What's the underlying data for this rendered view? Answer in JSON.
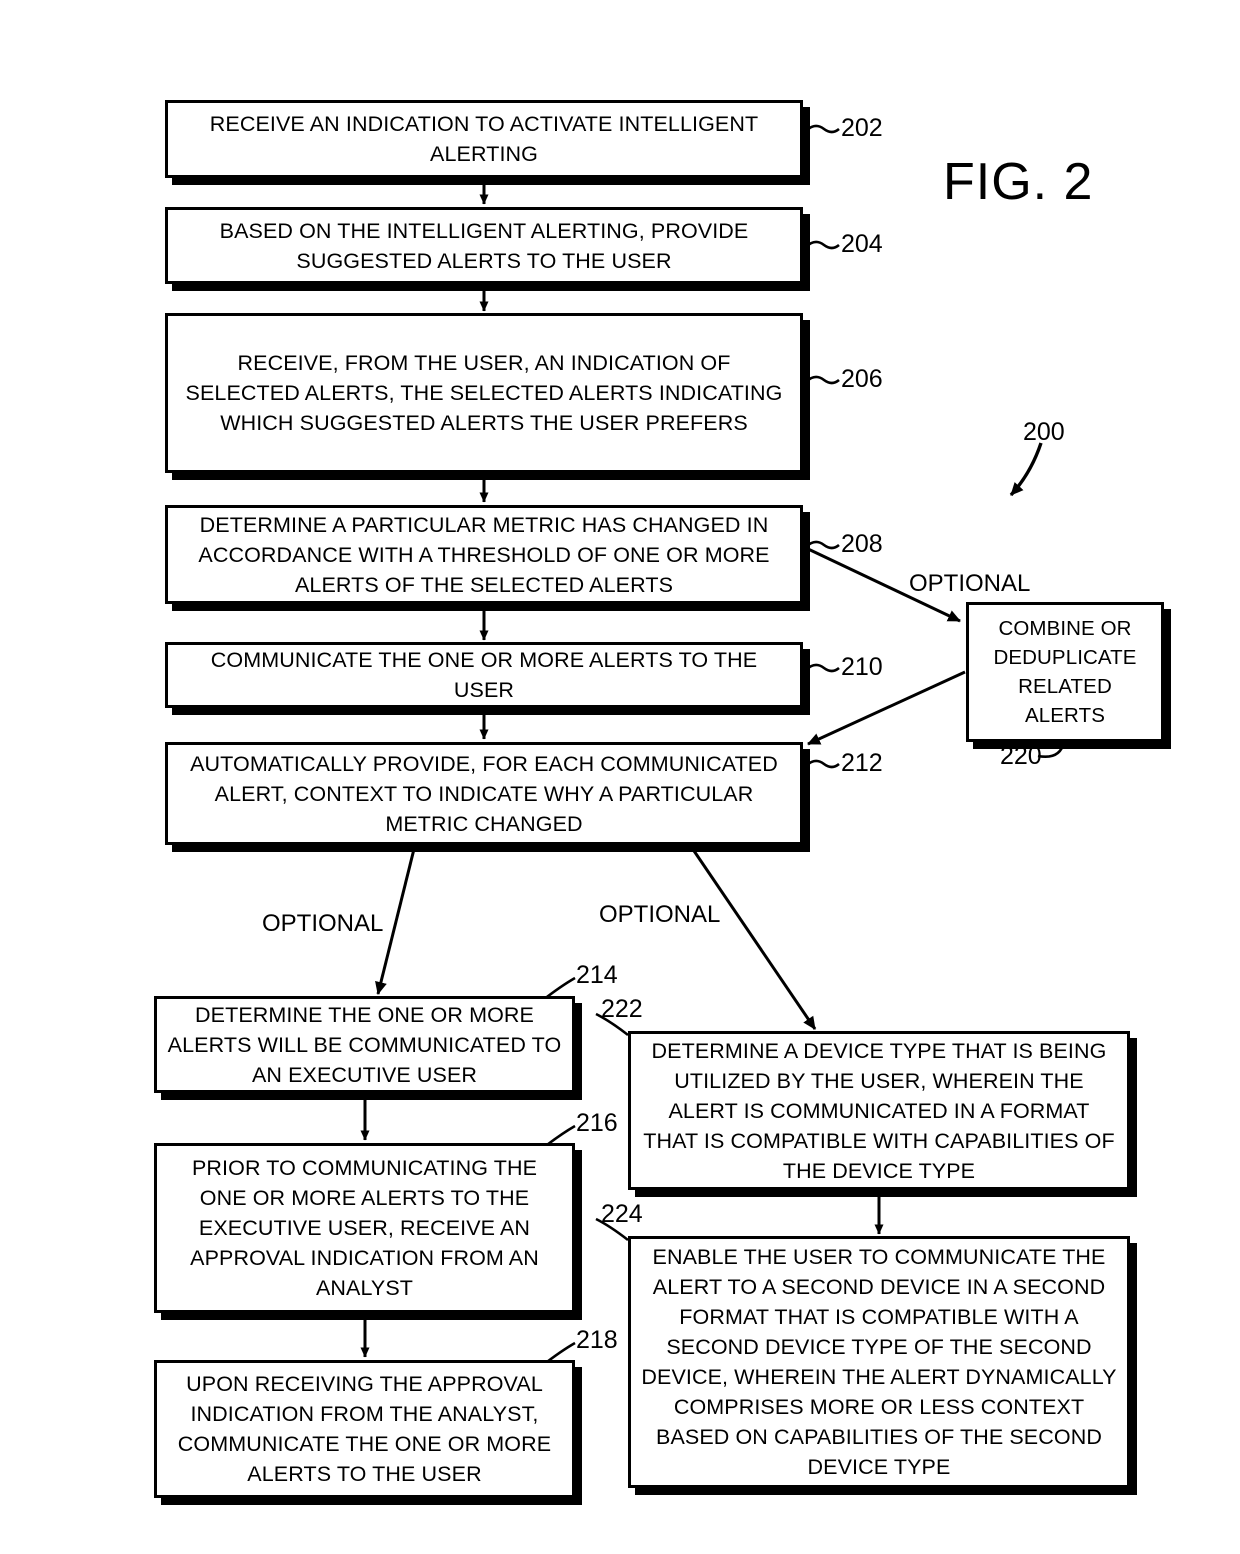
{
  "figure": {
    "title": "FIG. 2",
    "diagram_ref": "200"
  },
  "edge_labels": {
    "optional_208_to_220": "OPTIONAL",
    "optional_212_to_214": "OPTIONAL",
    "optional_212_to_222": "OPTIONAL"
  },
  "nodes": [
    {
      "ref": "202",
      "text": "RECEIVE AN INDICATION TO ACTIVATE INTELLIGENT ALERTING"
    },
    {
      "ref": "204",
      "text": "BASED ON THE INTELLIGENT ALERTING, PROVIDE SUGGESTED ALERTS TO THE USER"
    },
    {
      "ref": "206",
      "text": "RECEIVE, FROM THE USER, AN INDICATION OF SELECTED ALERTS, THE SELECTED ALERTS INDICATING WHICH SUGGESTED ALERTS THE USER PREFERS"
    },
    {
      "ref": "208",
      "text": "DETERMINE A PARTICULAR METRIC HAS CHANGED IN ACCORDANCE WITH A THRESHOLD OF ONE OR MORE ALERTS OF THE SELECTED ALERTS"
    },
    {
      "ref": "210",
      "text": "COMMUNICATE THE ONE OR MORE ALERTS TO THE USER"
    },
    {
      "ref": "212",
      "text": "AUTOMATICALLY PROVIDE, FOR EACH COMMUNICATED ALERT, CONTEXT TO INDICATE WHY A PARTICULAR METRIC CHANGED"
    },
    {
      "ref": "220",
      "text": "COMBINE OR DEDUPLICATE RELATED ALERTS"
    },
    {
      "ref": "214",
      "text": "DETERMINE THE ONE OR MORE ALERTS WILL BE COMMUNICATED TO AN EXECUTIVE USER"
    },
    {
      "ref": "216",
      "text": "PRIOR TO COMMUNICATING THE ONE OR MORE ALERTS TO THE EXECUTIVE USER, RECEIVE AN APPROVAL INDICATION FROM AN ANALYST"
    },
    {
      "ref": "218",
      "text": "UPON RECEIVING THE APPROVAL INDICATION FROM THE ANALYST, COMMUNICATE THE ONE OR MORE ALERTS TO THE USER"
    },
    {
      "ref": "222",
      "text": "DETERMINE A DEVICE TYPE THAT IS BEING UTILIZED BY THE USER, WHEREIN THE ALERT IS COMMUNICATED IN A FORMAT THAT IS COMPATIBLE WITH CAPABILITIES OF THE DEVICE TYPE"
    },
    {
      "ref": "224",
      "text": "ENABLE THE USER TO COMMUNICATE THE ALERT TO A SECOND DEVICE IN A SECOND FORMAT THAT IS COMPATIBLE WITH A SECOND DEVICE TYPE OF THE SECOND DEVICE, WHEREIN THE ALERT DYNAMICALLY COMPRISES MORE OR LESS CONTEXT BASED ON CAPABILITIES OF THE SECOND DEVICE TYPE"
    }
  ],
  "colors": {
    "stroke": "#000000",
    "fill": "#ffffff"
  }
}
